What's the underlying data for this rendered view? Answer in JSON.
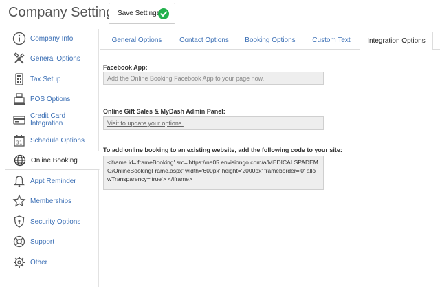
{
  "header": {
    "title": "Company Settings",
    "save_label": "Save Settings"
  },
  "sidebar": {
    "items": [
      {
        "label": "Company Info",
        "icon": "info-icon"
      },
      {
        "label": "General Options",
        "icon": "tools-icon"
      },
      {
        "label": "Tax Setup",
        "icon": "calculator-icon"
      },
      {
        "label": "POS Options",
        "icon": "register-icon"
      },
      {
        "label": "Credit Card Integration",
        "icon": "credit-card-icon"
      },
      {
        "label": "Schedule Options",
        "icon": "calendar-icon"
      },
      {
        "label": "Online Booking",
        "icon": "globe-icon",
        "active": true
      },
      {
        "label": "Appt Reminder",
        "icon": "bell-icon"
      },
      {
        "label": "Memberships",
        "icon": "star-icon"
      },
      {
        "label": "Security Options",
        "icon": "shield-icon"
      },
      {
        "label": "Support",
        "icon": "lifebuoy-icon"
      },
      {
        "label": "Other",
        "icon": "gear-icon"
      }
    ]
  },
  "tabs": [
    {
      "label": "General Options"
    },
    {
      "label": "Contact Options"
    },
    {
      "label": "Booking Options"
    },
    {
      "label": "Custom Text"
    },
    {
      "label": "Integration Options",
      "active": true
    }
  ],
  "content": {
    "facebook_label": "Facebook App:",
    "facebook_value": "Add the Online Booking Facebook App to your page now.",
    "gift_label": "Online Gift Sales & MyDash Admin Panel:",
    "gift_value": "Visit to update your options.",
    "code_label": "To add online booking to an existing website, add the following code to your site:",
    "code_value": "<iframe id='frameBooking' src='https://na05.envisiongo.com/a/MEDICALSPADEMO/OnlineBookingFrame.aspx' width='600px' height='2000px' frameborder='0' allowTransparency='true'> </iframe>"
  },
  "colors": {
    "link": "#3b6fb5",
    "check": "#22b14c",
    "field_bg": "#eeeeee"
  }
}
